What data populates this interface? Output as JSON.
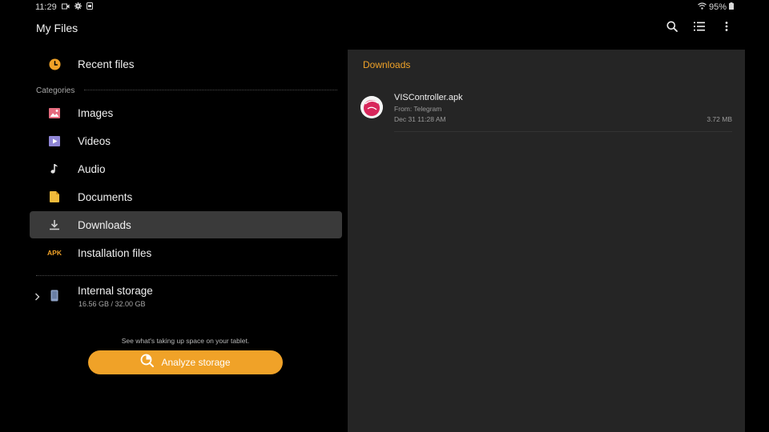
{
  "status_bar": {
    "time": "11:29",
    "battery": "95%",
    "icons": [
      "video-record-icon",
      "settings-gear-icon",
      "sim-card-icon",
      "wifi-icon",
      "battery-icon"
    ]
  },
  "app_bar": {
    "title": "My Files",
    "actions": [
      "search-icon",
      "list-view-icon",
      "more-options-icon"
    ]
  },
  "sidebar": {
    "recent": {
      "label": "Recent files",
      "icon": "clock-icon"
    },
    "categories_heading": "Categories",
    "categories": [
      {
        "label": "Images",
        "icon": "image-icon"
      },
      {
        "label": "Videos",
        "icon": "video-icon"
      },
      {
        "label": "Audio",
        "icon": "music-note-icon"
      },
      {
        "label": "Documents",
        "icon": "document-icon"
      },
      {
        "label": "Downloads",
        "icon": "download-icon",
        "selected": true
      },
      {
        "label": "Installation files",
        "icon_text": "APK"
      }
    ],
    "storage": {
      "title": "Internal storage",
      "usage": "16.56 GB / 32.00 GB",
      "icon": "phone-icon"
    },
    "hint": "See what's taking up space on your tablet.",
    "analyze_button": "Analyze storage"
  },
  "content": {
    "title": "Downloads",
    "files": [
      {
        "name": "VISController.apk",
        "from": "From: Telegram",
        "date": "Dec 31 11:28 AM",
        "size": "3.72 MB"
      }
    ]
  },
  "colors": {
    "accent": "#f0a228",
    "selected_bg": "#3a3a3a",
    "pane_bg": "#252525",
    "clock": "#f0a228",
    "image": "#e56b7e",
    "video": "#8f86d6",
    "audio": "#e2e2e2",
    "document": "#f1bb3b"
  }
}
